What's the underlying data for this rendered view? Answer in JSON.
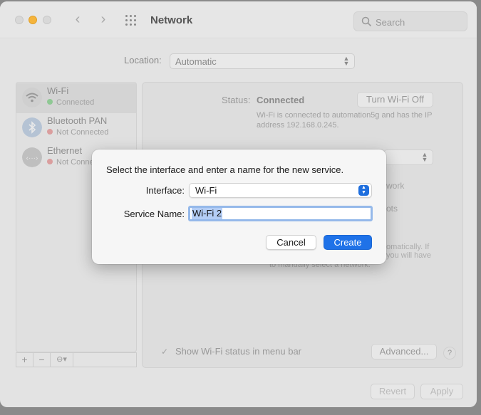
{
  "window": {
    "title": "Network",
    "search_placeholder": "Search"
  },
  "location": {
    "label": "Location:",
    "value": "Automatic"
  },
  "services": [
    {
      "name": "Wi-Fi",
      "status": "Connected",
      "status_color": "#3fbf4f"
    },
    {
      "name": "Bluetooth PAN",
      "status": "Not Connected",
      "status_color": "#e05a5a"
    },
    {
      "name": "Ethernet",
      "status": "Not Connected",
      "status_color": "#e05a5a"
    }
  ],
  "sidebar_tools": [
    "+",
    "−",
    "⊖▾"
  ],
  "detail": {
    "status_label": "Status:",
    "status_value": "Connected",
    "turn_off_button": "Turn Wi-Fi Off",
    "status_description": "Wi-Fi is connected to automation5g and has the IP address 192.168.0.245.",
    "partial_network": "work",
    "partial_hotspots": "ots",
    "partial_auto_1": "omatically. If",
    "partial_auto_2": "you will have",
    "partial_auto_3": "to manually select a network.",
    "show_status_label": "Show Wi-Fi status in menu bar",
    "advanced_button": "Advanced...",
    "help_label": "?",
    "revert_button": "Revert",
    "apply_button": "Apply"
  },
  "sheet": {
    "prompt": "Select the interface and enter a name for the new service.",
    "interface_label": "Interface:",
    "interface_value": "Wi-Fi",
    "service_name_label": "Service Name:",
    "service_name_value": "Wi-Fi 2",
    "cancel_button": "Cancel",
    "create_button": "Create"
  },
  "colors": {
    "accent": "#1f72e8",
    "selection": "#b3cdf5",
    "focus_ring": "#95b9ea"
  }
}
